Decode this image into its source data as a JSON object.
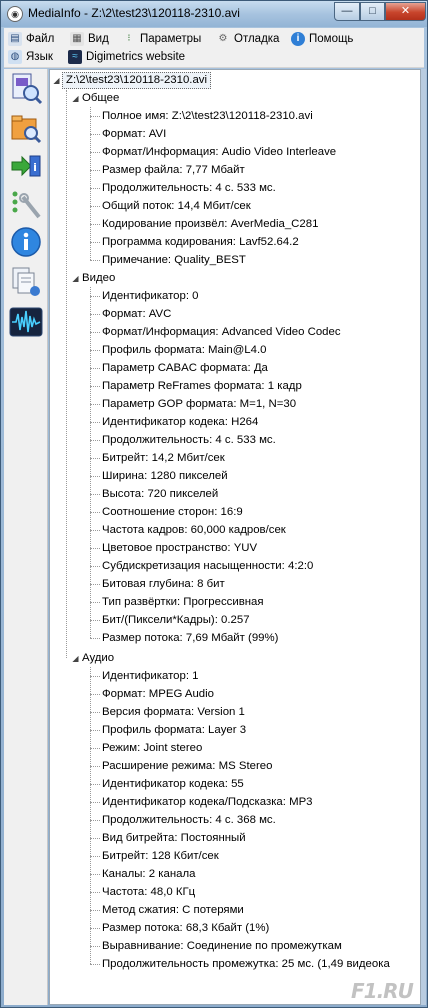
{
  "window": {
    "title": "MediaInfo - Z:\\2\\test23\\120118-2310.avi",
    "buttons": {
      "minimize": "—",
      "maximize": "□",
      "close": "✕"
    }
  },
  "menu": {
    "row1": [
      {
        "label": "Файл",
        "icon": "file-icon"
      },
      {
        "label": "Вид",
        "icon": "view-icon"
      },
      {
        "label": "Параметры",
        "icon": "settings-icon"
      },
      {
        "label": "Отладка",
        "icon": "debug-icon"
      },
      {
        "label": "Помощь",
        "icon": "help-icon"
      }
    ],
    "row2": [
      {
        "label": "Язык",
        "icon": "language-icon"
      },
      {
        "label": "Digimetrics website",
        "icon": "website-icon"
      }
    ]
  },
  "sidebar": [
    {
      "name": "open-file-icon"
    },
    {
      "name": "open-folder-icon"
    },
    {
      "name": "export-icon"
    },
    {
      "name": "preferences-icon"
    },
    {
      "name": "about-icon"
    },
    {
      "name": "file-list-icon"
    },
    {
      "name": "waveform-icon"
    }
  ],
  "tree": {
    "root": "Z:\\2\\test23\\120118-2310.avi",
    "sections": [
      {
        "title": "Общее",
        "items": [
          "Полное имя: Z:\\2\\test23\\120118-2310.avi",
          "Формат: AVI",
          "Формат/Информация: Audio Video Interleave",
          "Размер файла: 7,77 Мбайт",
          "Продолжительность: 4 с. 533 мс.",
          "Общий поток: 14,4 Мбит/сек",
          "Кодирование произвёл: AverMedia_C281",
          "Программа кодирования: Lavf52.64.2",
          "Примечание: Quality_BEST"
        ]
      },
      {
        "title": "Видео",
        "items": [
          "Идентификатор: 0",
          "Формат: AVC",
          "Формат/Информация: Advanced Video Codec",
          "Профиль формата: Main@L4.0",
          "Параметр CABAC формата: Да",
          "Параметр ReFrames формата: 1 кадр",
          "Параметр GOP формата: M=1, N=30",
          "Идентификатор кодека: H264",
          "Продолжительность: 4 с. 533 мс.",
          "Битрейт: 14,2 Мбит/сек",
          "Ширина: 1280 пикселей",
          "Высота: 720 пикселей",
          "Соотношение сторон: 16:9",
          "Частота кадров: 60,000 кадров/сек",
          "Цветовое пространство: YUV",
          "Субдискретизация насыщенности: 4:2:0",
          "Битовая глубина: 8 бит",
          "Тип развёртки: Прогрессивная",
          "Бит/(Пиксели*Кадры): 0.257",
          "Размер потока: 7,69 Мбайт (99%)"
        ]
      },
      {
        "title": "Аудио",
        "items": [
          "Идентификатор: 1",
          "Формат: MPEG Audio",
          "Версия формата: Version 1",
          "Профиль формата: Layer 3",
          "Режим: Joint stereo",
          "Расширение режима: MS Stereo",
          "Идентификатор кодека: 55",
          "Идентификатор кодека/Подсказка: MP3",
          "Продолжительность: 4 с. 368 мс.",
          "Вид битрейта: Постоянный",
          "Битрейт: 128 Кбит/сек",
          "Каналы: 2 канала",
          "Частота: 48,0 КГц",
          "Метод сжатия: С потерями",
          "Размер потока: 68,3 Кбайт (1%)",
          "Выравнивание: Соединение по промежуткам",
          "Продолжительность промежутка: 25  мс. (1,49 видеока"
        ]
      }
    ]
  },
  "watermark": "F1.RU"
}
